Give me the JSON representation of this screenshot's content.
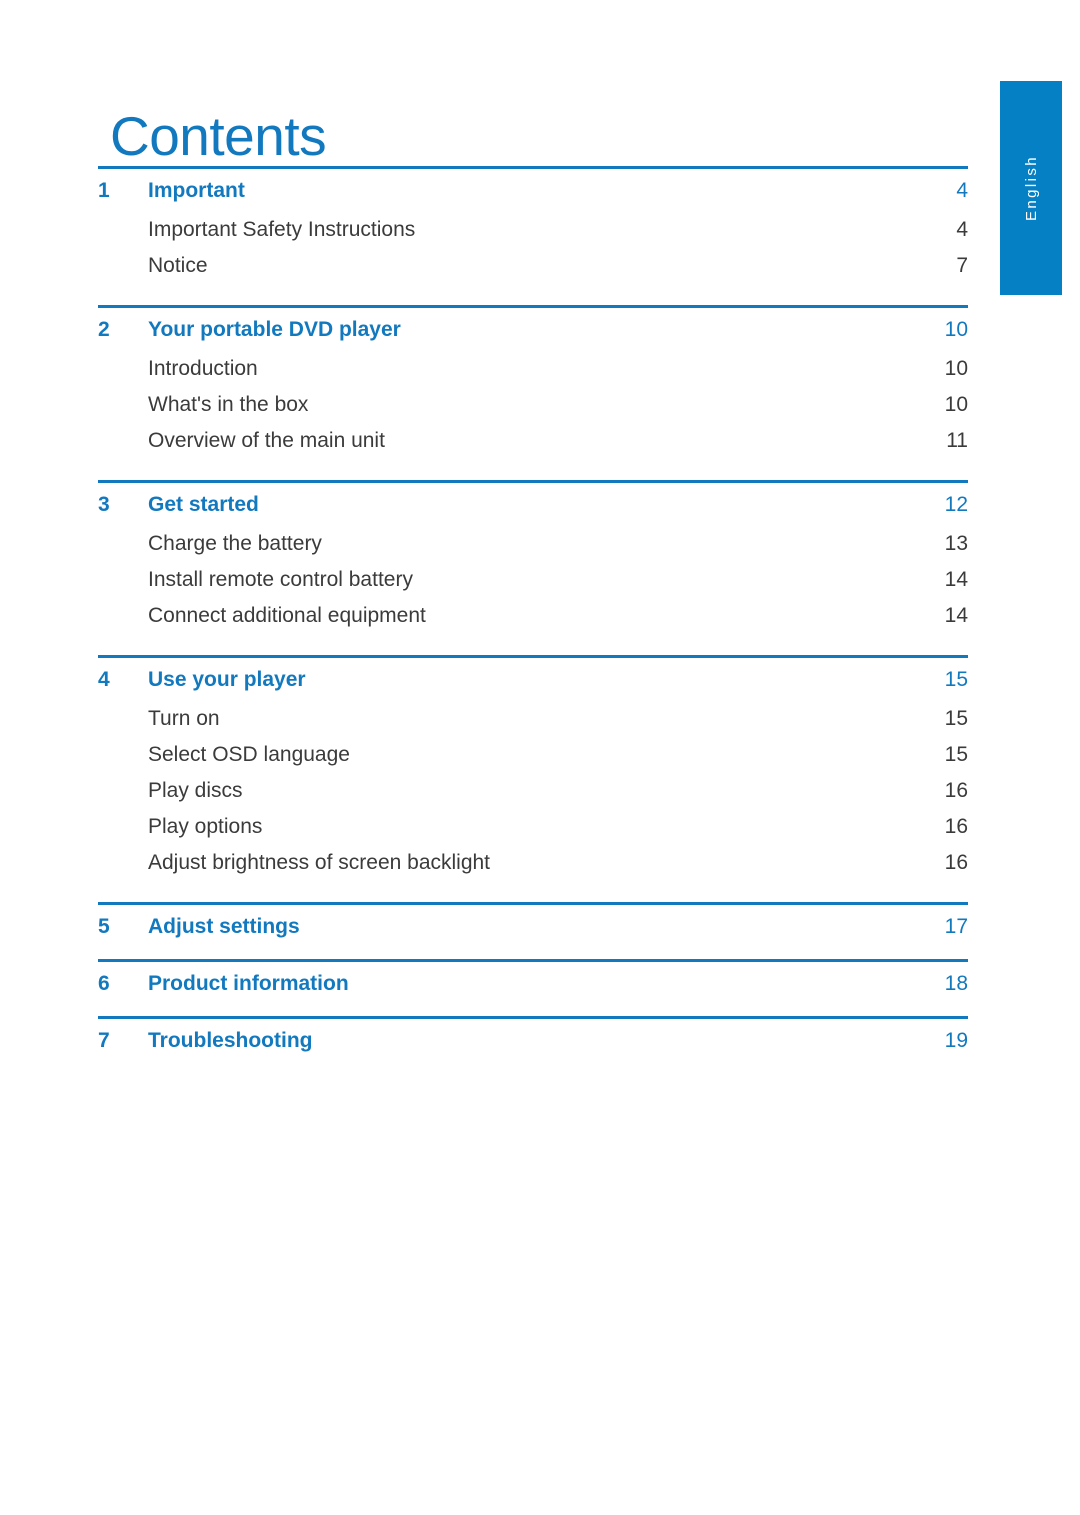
{
  "document": {
    "title": "Contents",
    "language_tab": "English",
    "accent_color": "#1279BF",
    "tab_color": "#0580C4",
    "body_text_color": "#3B3B3B"
  },
  "toc": {
    "sections": [
      {
        "number": "1",
        "title": "Important",
        "page": "4",
        "entries": [
          {
            "label": "Important Safety Instructions",
            "page": "4"
          },
          {
            "label": "Notice",
            "page": "7"
          }
        ]
      },
      {
        "number": "2",
        "title": "Your portable DVD player",
        "page": "10",
        "entries": [
          {
            "label": "Introduction",
            "page": "10"
          },
          {
            "label": "What's in the box",
            "page": "10"
          },
          {
            "label": "Overview of the main unit",
            "page": "11"
          }
        ]
      },
      {
        "number": "3",
        "title": "Get started",
        "page": "12",
        "entries": [
          {
            "label": "Charge the battery",
            "page": "13"
          },
          {
            "label": "Install remote control battery",
            "page": "14"
          },
          {
            "label": "Connect additional equipment",
            "page": "14"
          }
        ]
      },
      {
        "number": "4",
        "title": "Use your player",
        "page": "15",
        "entries": [
          {
            "label": "Turn on",
            "page": "15"
          },
          {
            "label": "Select OSD language",
            "page": "15"
          },
          {
            "label": "Play discs",
            "page": "16"
          },
          {
            "label": "Play options",
            "page": "16"
          },
          {
            "label": "Adjust brightness of screen backlight",
            "page": "16"
          }
        ]
      },
      {
        "number": "5",
        "title": "Adjust settings",
        "page": "17",
        "entries": []
      },
      {
        "number": "6",
        "title": "Product information",
        "page": "18",
        "entries": []
      },
      {
        "number": "7",
        "title": "Troubleshooting",
        "page": "19",
        "entries": []
      }
    ]
  }
}
